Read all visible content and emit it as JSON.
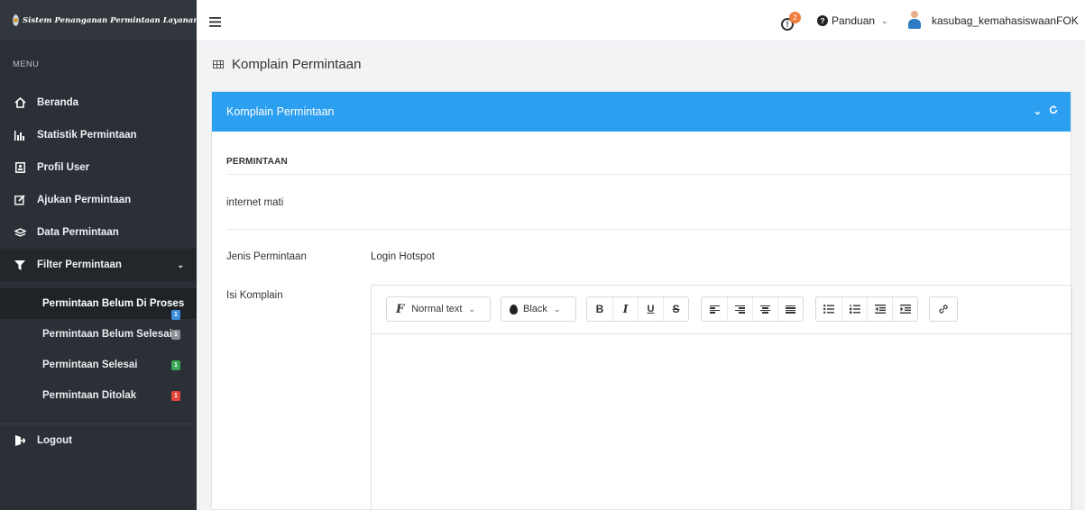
{
  "brand": {
    "title": "Sistem Penanganan Permintaan Layanan"
  },
  "sidebar": {
    "menu_label": "MENU",
    "items": [
      {
        "label": "Beranda",
        "icon": "home-icon"
      },
      {
        "label": "Statistik Permintaan",
        "icon": "bar-chart-icon"
      },
      {
        "label": "Profil User",
        "icon": "id-card-icon"
      },
      {
        "label": "Ajukan Permintaan",
        "icon": "edit-icon"
      },
      {
        "label": "Data Permintaan",
        "icon": "stack-icon"
      },
      {
        "label": "Filter Permintaan",
        "icon": "filter-icon"
      }
    ],
    "subitems": [
      {
        "label": "Permintaan Belum Di Proses",
        "badge": "1",
        "badge_color": "#3b8fdb"
      },
      {
        "label": "Permintaan Belum Selesai",
        "badge": "1",
        "badge_color": "#8a8f94"
      },
      {
        "label": "Permintaan Selesai",
        "badge": "1",
        "badge_color": "#3aa757"
      },
      {
        "label": "Permintaan Ditolak",
        "badge": "1",
        "badge_color": "#e2453b"
      }
    ],
    "logout": "Logout"
  },
  "topbar": {
    "alert_icon": "!",
    "alert_count": "2",
    "help_icon": "?",
    "help_label": "Panduan",
    "username": "kasubag_kemahasiswaanFOK"
  },
  "page": {
    "title": "Komplain Permintaan"
  },
  "card": {
    "header": "Komplain Permintaan",
    "header_color": "#2d9ff0",
    "section_title": "PERMINTAAN",
    "request_text": "internet mati",
    "jenis_label": "Jenis Permintaan",
    "jenis_value": "Login Hotspot",
    "isi_label": "Isi Komplain"
  },
  "editor": {
    "font_label": "Normal text",
    "color_label": "Black",
    "bold": "B",
    "italic": "I",
    "underline": "U",
    "strike": "S"
  }
}
